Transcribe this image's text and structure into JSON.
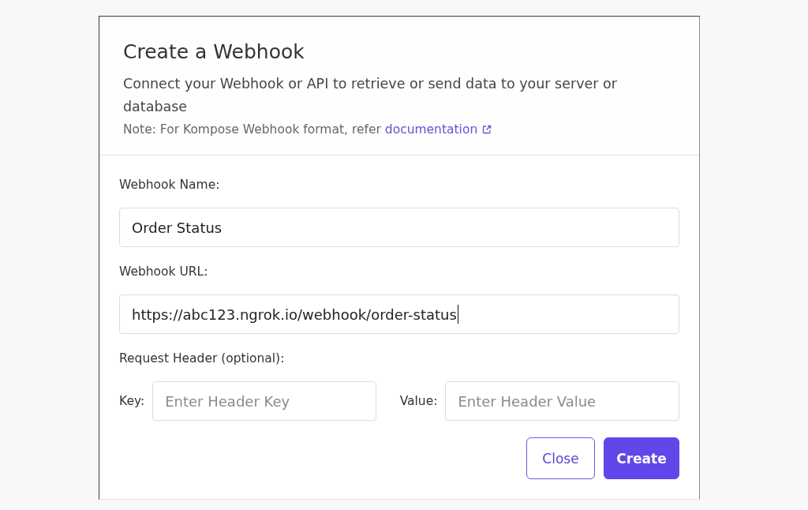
{
  "dialog": {
    "title": "Create a Webhook",
    "description": "Connect your Webhook or API to retrieve or send data to your server or database",
    "note": {
      "text": "Note: For Kompose Webhook format, refer",
      "link": "documentation"
    },
    "fields": [
      {
        "label": "Webhook Name:",
        "value": "Order Status",
        "focused": false
      },
      {
        "label": "Webhook URL:",
        "value": "https://abc123.ngrok.io/webhook/order-status",
        "focused": true
      }
    ],
    "request_header": {
      "label": "Request Header (optional):",
      "fields": [
        {
          "label": "Key:",
          "placeholder": "Enter Header Key",
          "focused": false
        },
        {
          "label": "Value:",
          "placeholder": "Enter Header Value",
          "focused": false
        }
      ]
    },
    "buttons": [
      {
        "label": "Close",
        "kind": "secondary"
      },
      {
        "label": "Create",
        "kind": "primary"
      }
    ]
  }
}
